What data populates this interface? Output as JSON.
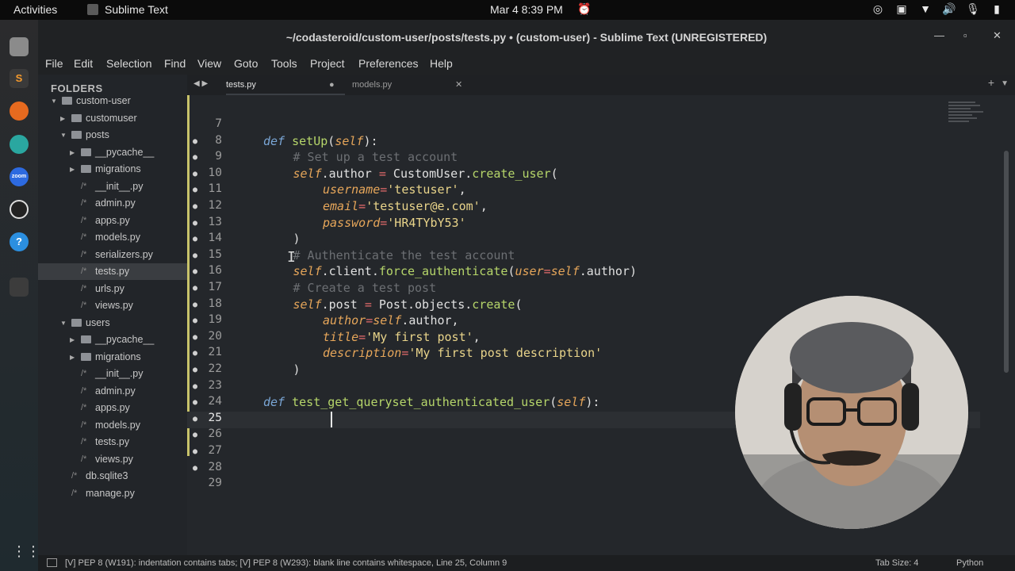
{
  "topbar": {
    "activities": "Activities",
    "app_name": "Sublime Text",
    "clock": "Mar 4  8:39 PM"
  },
  "window": {
    "title": "~/codasteroid/custom-user/posts/tests.py • (custom-user) - Sublime Text (UNREGISTERED)"
  },
  "menu": [
    "File",
    "Edit",
    "Selection",
    "Find",
    "View",
    "Goto",
    "Tools",
    "Project",
    "Preferences",
    "Help"
  ],
  "sidebar": {
    "header": "FOLDERS",
    "items": [
      {
        "label": "custom-user",
        "kind": "folder-open",
        "depth": 0
      },
      {
        "label": "customuser",
        "kind": "folder",
        "depth": 1
      },
      {
        "label": "posts",
        "kind": "folder-open",
        "depth": 1
      },
      {
        "label": "__pycache__",
        "kind": "folder",
        "depth": 2
      },
      {
        "label": "migrations",
        "kind": "folder",
        "depth": 2
      },
      {
        "label": "__init__.py",
        "kind": "file",
        "depth": 2
      },
      {
        "label": "admin.py",
        "kind": "file",
        "depth": 2
      },
      {
        "label": "apps.py",
        "kind": "file",
        "depth": 2
      },
      {
        "label": "models.py",
        "kind": "file",
        "depth": 2
      },
      {
        "label": "serializers.py",
        "kind": "file",
        "depth": 2
      },
      {
        "label": "tests.py",
        "kind": "file",
        "depth": 2,
        "selected": true
      },
      {
        "label": "urls.py",
        "kind": "file",
        "depth": 2
      },
      {
        "label": "views.py",
        "kind": "file",
        "depth": 2
      },
      {
        "label": "users",
        "kind": "folder-open",
        "depth": 1
      },
      {
        "label": "__pycache__",
        "kind": "folder",
        "depth": 2
      },
      {
        "label": "migrations",
        "kind": "folder",
        "depth": 2
      },
      {
        "label": "__init__.py",
        "kind": "file",
        "depth": 2
      },
      {
        "label": "admin.py",
        "kind": "file",
        "depth": 2
      },
      {
        "label": "apps.py",
        "kind": "file",
        "depth": 2
      },
      {
        "label": "models.py",
        "kind": "file",
        "depth": 2
      },
      {
        "label": "tests.py",
        "kind": "file",
        "depth": 2
      },
      {
        "label": "views.py",
        "kind": "file",
        "depth": 2
      },
      {
        "label": "db.sqlite3",
        "kind": "file",
        "depth": 1
      },
      {
        "label": "manage.py",
        "kind": "file",
        "depth": 1
      }
    ]
  },
  "tabs": [
    {
      "label": "tests.py",
      "active": true,
      "modified": true
    },
    {
      "label": "models.py",
      "active": false,
      "modified": false
    }
  ],
  "editor": {
    "lines": [
      {
        "num": "7",
        "tokens": []
      },
      {
        "num": "8",
        "tokens": [
          [
            "kw",
            "def "
          ],
          [
            "fn",
            "setUp"
          ],
          [
            "cls",
            "("
          ],
          [
            "slf",
            "self"
          ],
          [
            "cls",
            "):"
          ]
        ],
        "indent": 1
      },
      {
        "num": "9",
        "tokens": [
          [
            "cm",
            "# Set up a test account"
          ]
        ],
        "indent": 2
      },
      {
        "num": "10",
        "tokens": [
          [
            "slf",
            "self"
          ],
          [
            "cls",
            ".author "
          ],
          [
            "op",
            "="
          ],
          [
            "cls",
            " CustomUser."
          ],
          [
            "fn",
            "create_user"
          ],
          [
            "cls",
            "("
          ]
        ],
        "indent": 2
      },
      {
        "num": "11",
        "tokens": [
          [
            "arg",
            "username"
          ],
          [
            "op",
            "="
          ],
          [
            "str",
            "'testuser'"
          ],
          [
            "cls",
            ","
          ]
        ],
        "indent": 3
      },
      {
        "num": "12",
        "tokens": [
          [
            "arg",
            "email"
          ],
          [
            "op",
            "="
          ],
          [
            "str",
            "'testuser@e.com'"
          ],
          [
            "cls",
            ","
          ]
        ],
        "indent": 3
      },
      {
        "num": "13",
        "tokens": [
          [
            "arg",
            "password"
          ],
          [
            "op",
            "="
          ],
          [
            "str",
            "'HR4TYbY53'"
          ]
        ],
        "indent": 3
      },
      {
        "num": "14",
        "tokens": [
          [
            "cls",
            ")"
          ]
        ],
        "indent": 2
      },
      {
        "num": "15",
        "tokens": [
          [
            "cm",
            "# Authenticate the test account"
          ]
        ],
        "indent": 2
      },
      {
        "num": "16",
        "tokens": [
          [
            "slf",
            "self"
          ],
          [
            "cls",
            ".client."
          ],
          [
            "fn",
            "force_authenticate"
          ],
          [
            "cls",
            "("
          ],
          [
            "arg",
            "user"
          ],
          [
            "op",
            "="
          ],
          [
            "slf",
            "self"
          ],
          [
            "cls",
            ".author)"
          ]
        ],
        "indent": 2
      },
      {
        "num": "17",
        "tokens": [
          [
            "cm",
            "# Create a test post"
          ]
        ],
        "indent": 2
      },
      {
        "num": "18",
        "tokens": [
          [
            "slf",
            "self"
          ],
          [
            "cls",
            ".post "
          ],
          [
            "op",
            "="
          ],
          [
            "cls",
            " Post.objects."
          ],
          [
            "fn",
            "create"
          ],
          [
            "cls",
            "("
          ]
        ],
        "indent": 2
      },
      {
        "num": "19",
        "tokens": [
          [
            "arg",
            "author"
          ],
          [
            "op",
            "="
          ],
          [
            "slf",
            "self"
          ],
          [
            "cls",
            ".author,"
          ]
        ],
        "indent": 3
      },
      {
        "num": "20",
        "tokens": [
          [
            "arg",
            "title"
          ],
          [
            "op",
            "="
          ],
          [
            "str",
            "'My first post'"
          ],
          [
            "cls",
            ","
          ]
        ],
        "indent": 3
      },
      {
        "num": "21",
        "tokens": [
          [
            "arg",
            "description"
          ],
          [
            "op",
            "="
          ],
          [
            "str",
            "'My first post description'"
          ]
        ],
        "indent": 3
      },
      {
        "num": "22",
        "tokens": [
          [
            "cls",
            ")"
          ]
        ],
        "indent": 2
      },
      {
        "num": "23",
        "tokens": []
      },
      {
        "num": "24",
        "tokens": [
          [
            "kw",
            "def "
          ],
          [
            "fn",
            "test_get_queryset_authenticated_user"
          ],
          [
            "cls",
            "("
          ],
          [
            "slf",
            "self"
          ],
          [
            "cls",
            "):"
          ]
        ],
        "indent": 1
      },
      {
        "num": "25",
        "tokens": [],
        "current": true
      },
      {
        "num": "26",
        "tokens": []
      },
      {
        "num": "27",
        "tokens": []
      },
      {
        "num": "28",
        "tokens": []
      },
      {
        "num": "29",
        "tokens": []
      }
    ]
  },
  "statusbar": {
    "message": "[V] PEP 8 (W191): indentation contains tabs; [V] PEP 8 (W293): blank line contains whitespace, Line 25, Column 9",
    "tab_size": "Tab Size: 4",
    "syntax": "Python"
  },
  "colors": {
    "accent_gutter": "#c8c36a",
    "keyword": "#7aa6d6",
    "function": "#b6d66a",
    "string": "#e9d48a",
    "comment": "#6c6f73"
  }
}
